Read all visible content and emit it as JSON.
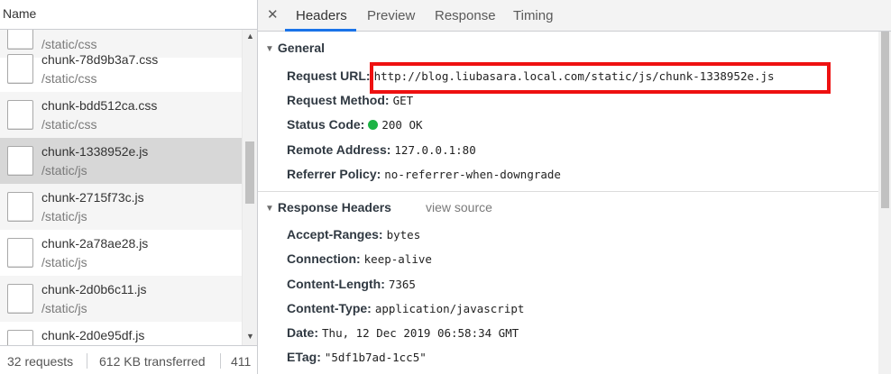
{
  "left_panel": {
    "header": "Name",
    "files": [
      {
        "name": "",
        "path": "/static/css",
        "state": "alt"
      },
      {
        "name": "chunk-78d9b3a7.css",
        "path": "/static/css",
        "state": "normal"
      },
      {
        "name": "chunk-bdd512ca.css",
        "path": "/static/css",
        "state": "alt"
      },
      {
        "name": "chunk-1338952e.js",
        "path": "/static/js",
        "state": "selected"
      },
      {
        "name": "chunk-2715f73c.js",
        "path": "/static/js",
        "state": "alt"
      },
      {
        "name": "chunk-2a78ae28.js",
        "path": "/static/js",
        "state": "normal"
      },
      {
        "name": "chunk-2d0b6c11.js",
        "path": "/static/js",
        "state": "alt"
      },
      {
        "name": "chunk-2d0e95df.js",
        "path": "",
        "state": "normal"
      }
    ],
    "scroll_up": "▲",
    "scroll_down": "▼",
    "status": {
      "requests": "32 requests",
      "transferred": "612 KB transferred",
      "extra": "411"
    }
  },
  "tabs": {
    "close": "✕",
    "items": [
      "Headers",
      "Preview",
      "Response",
      "Timing"
    ],
    "active": "Headers"
  },
  "general": {
    "title": "General",
    "rows": [
      {
        "name": "Request URL:",
        "value": "http://blog.liubasara.local.com/static/js/chunk-1338952e.js"
      },
      {
        "name": "Request Method:",
        "value": "GET"
      },
      {
        "name": "Status Code:",
        "value": "200 OK"
      },
      {
        "name": "Remote Address:",
        "value": "127.0.0.1:80"
      },
      {
        "name": "Referrer Policy:",
        "value": "no-referrer-when-downgrade"
      }
    ]
  },
  "response_headers": {
    "title": "Response Headers",
    "view_source": "view source",
    "rows": [
      {
        "name": "Accept-Ranges:",
        "value": "bytes"
      },
      {
        "name": "Connection:",
        "value": "keep-alive"
      },
      {
        "name": "Content-Length:",
        "value": "7365"
      },
      {
        "name": "Content-Type:",
        "value": "application/javascript"
      },
      {
        "name": "Date:",
        "value": "Thu, 12 Dec 2019 06:58:34 GMT"
      },
      {
        "name": "ETag:",
        "value": "\"5df1b7ad-1cc5\""
      }
    ]
  },
  "icons": {
    "collapse_triangle": "triangle-down-icon",
    "file": "document-icon",
    "status": "green-dot-icon"
  },
  "colors": {
    "highlight_box": "#ee1111",
    "active_tab_underline": "#1a73e8",
    "status_ok": "#1db345",
    "selected_row": "#d7d7d7"
  }
}
